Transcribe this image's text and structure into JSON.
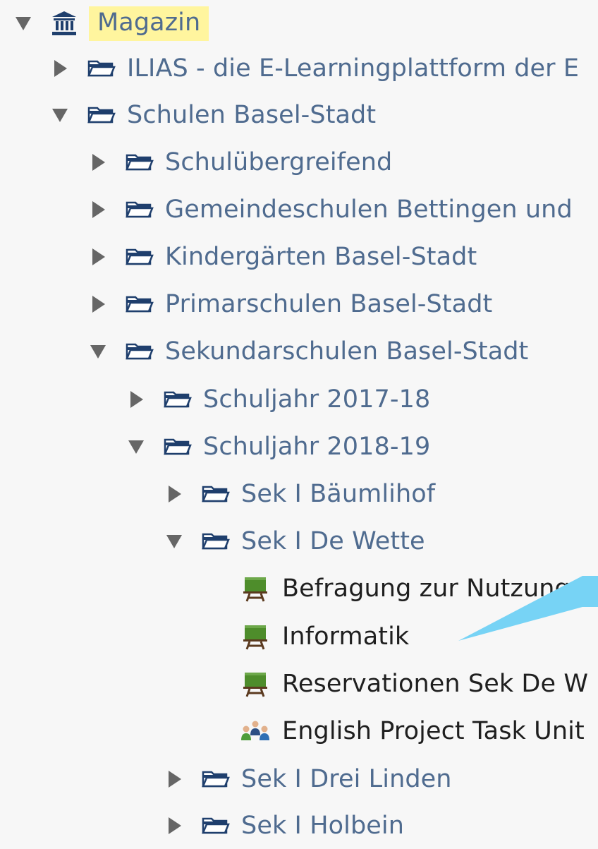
{
  "tree": {
    "root": {
      "label": "Magazin",
      "state": "expanded",
      "icon": "repository-icon"
    },
    "items": [
      {
        "label": "ILIAS - die E-Learningplattform der E",
        "state": "collapsed",
        "icon": "folder-icon"
      },
      {
        "label": "Schulen Basel-Stadt",
        "state": "expanded",
        "icon": "folder-icon"
      },
      {
        "label": "Schulübergreifend",
        "state": "collapsed",
        "icon": "folder-icon"
      },
      {
        "label": "Gemeindeschulen Bettingen und",
        "state": "collapsed",
        "icon": "folder-icon"
      },
      {
        "label": "Kindergärten Basel-Stadt",
        "state": "collapsed",
        "icon": "folder-icon"
      },
      {
        "label": "Primarschulen Basel-Stadt",
        "state": "collapsed",
        "icon": "folder-icon"
      },
      {
        "label": "Sekundarschulen Basel-Stadt",
        "state": "expanded",
        "icon": "folder-icon"
      },
      {
        "label": "Schuljahr 2017-18",
        "state": "collapsed",
        "icon": "folder-icon"
      },
      {
        "label": "Schuljahr 2018-19",
        "state": "expanded",
        "icon": "folder-icon"
      },
      {
        "label": "Sek I Bäumlihof",
        "state": "collapsed",
        "icon": "folder-icon"
      },
      {
        "label": "Sek I De Wette",
        "state": "expanded",
        "icon": "folder-icon"
      },
      {
        "label": "Befragung zur Nutzung",
        "state": "leaf",
        "icon": "course-icon"
      },
      {
        "label": "Informatik",
        "state": "leaf",
        "icon": "course-icon"
      },
      {
        "label": "Reservationen Sek De W",
        "state": "leaf",
        "icon": "course-icon"
      },
      {
        "label": "English Project Task Unit",
        "state": "leaf",
        "icon": "group-icon"
      },
      {
        "label": "Sek I Drei Linden",
        "state": "collapsed",
        "icon": "folder-icon"
      },
      {
        "label": "Sek I Holbein",
        "state": "collapsed",
        "icon": "folder-icon"
      }
    ]
  },
  "colors": {
    "background": "#f7f7f7",
    "link_text": "#4f6b8f",
    "dark_text": "#1f1f1f",
    "highlight": "#fff59e",
    "toggle": "#666666",
    "folder": "#1f3f6d",
    "course_green": "#4e8d2b",
    "course_stand": "#5b3a1f",
    "callout": "#77d3f5"
  }
}
